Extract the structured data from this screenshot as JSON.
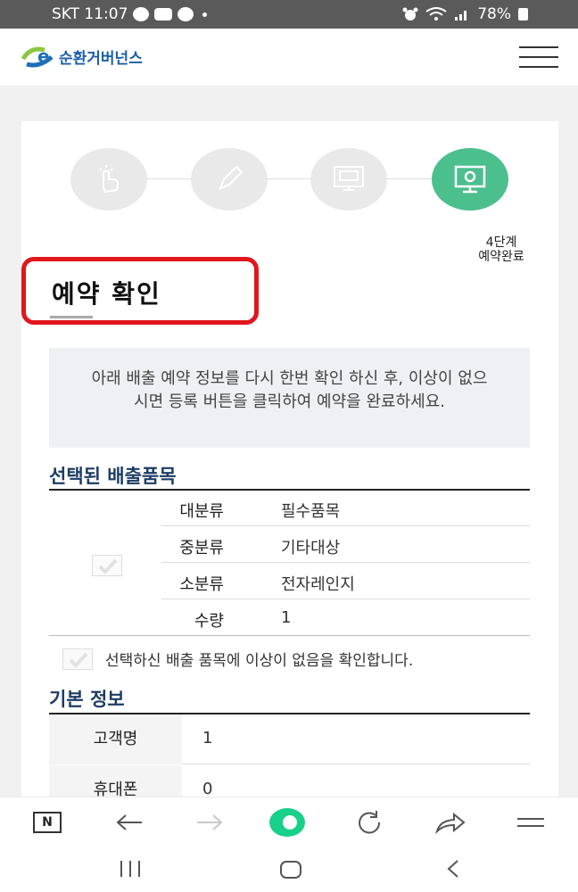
{
  "status_bar": {
    "carrier_time": "SKT 11:07",
    "battery": "78%"
  },
  "header": {
    "brand": "순환거버넌스",
    "logo_letter": "e"
  },
  "steps": {
    "items": [
      {
        "icon": "hand-pointer-icon",
        "active": false
      },
      {
        "icon": "pen-icon",
        "active": false
      },
      {
        "icon": "monitor-form-icon",
        "active": false
      },
      {
        "icon": "monitor-check-icon",
        "active": true
      }
    ],
    "active_label_line1": "4단계",
    "active_label_line2": "예약완료"
  },
  "page_title": "예약 확인",
  "notice": "아래 배출 예약 정보를 다시 한번 확인 하신 후, 이상이 없으시면 등록 버튼을 클릭하여 예약을 완료하세요.",
  "selected_items": {
    "section_title": "선택된 배출품목",
    "rows": [
      {
        "label": "대분류",
        "value": "필수품목"
      },
      {
        "label": "중분류",
        "value": "기타대상"
      },
      {
        "label": "소분류",
        "value": "전자레인지"
      },
      {
        "label": "수량",
        "value": "1"
      }
    ],
    "confirm_text": "선택하신 배출 품목에 이상이 없음을 확인합니다."
  },
  "basic_info": {
    "section_title": "기본 정보",
    "rows": [
      {
        "label": "고객명",
        "value": "1"
      },
      {
        "label": "휴대폰",
        "value": "0"
      }
    ]
  },
  "browser_bar": {
    "n_label": "N"
  },
  "colors": {
    "accent_green": "#4cbf8e",
    "highlight_red": "#e1161d",
    "section_navy": "#1c3d64"
  }
}
